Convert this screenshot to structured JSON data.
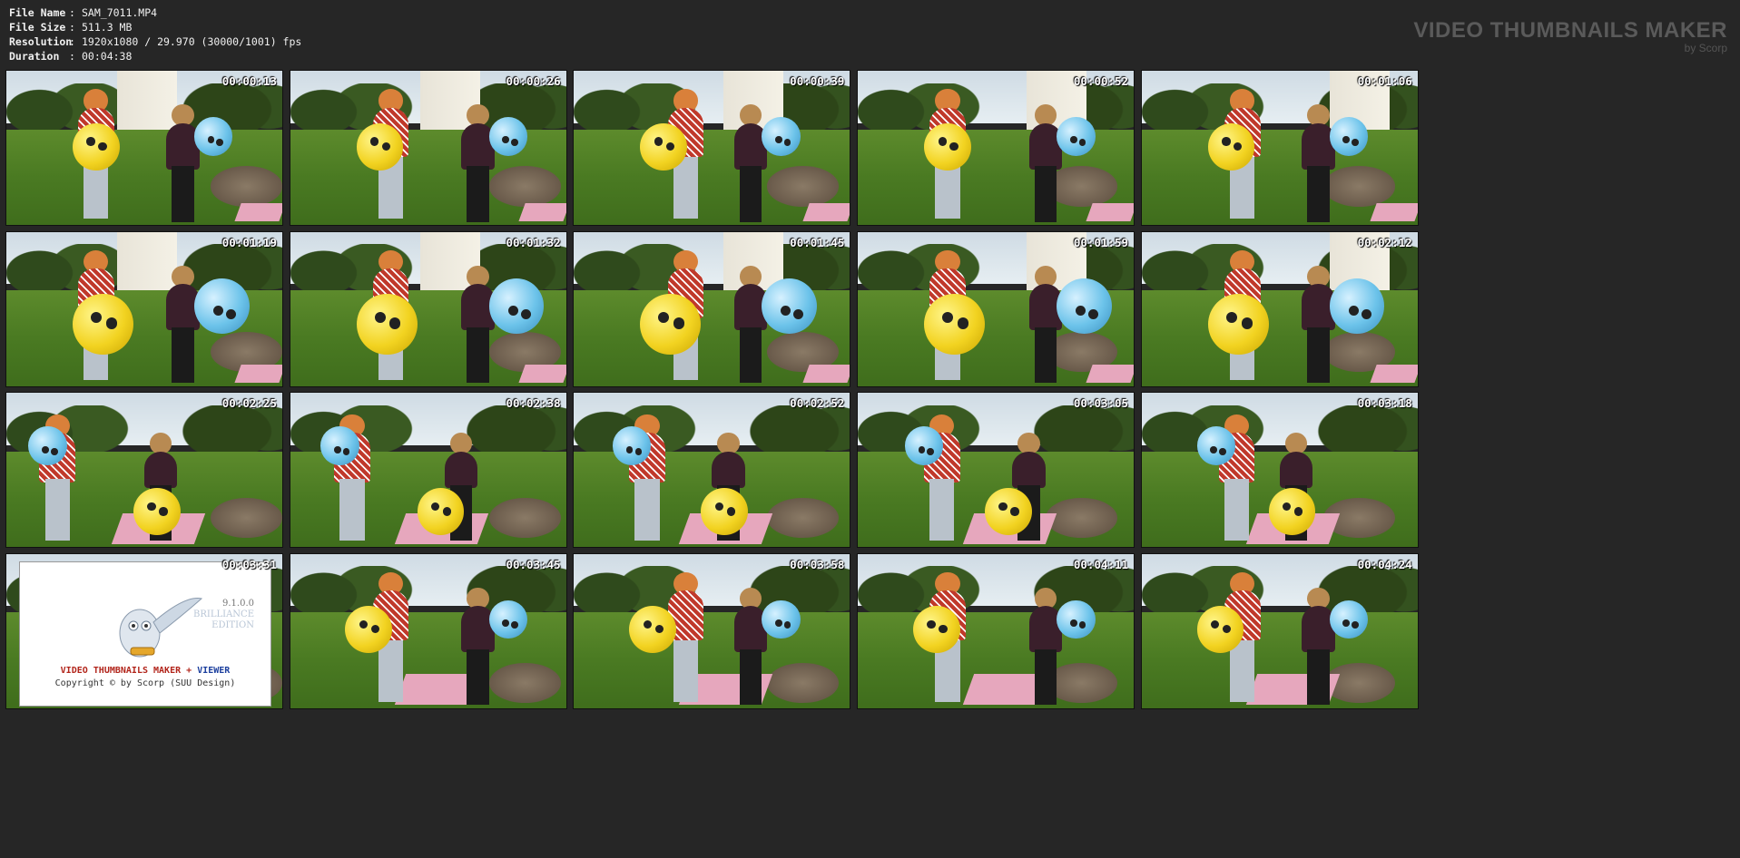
{
  "info": {
    "rows": [
      {
        "key": "File Name",
        "sep": ":",
        "value": "SAM_7011.MP4"
      },
      {
        "key": "File Size",
        "sep": ":",
        "value": "511.3 MB"
      },
      {
        "key": "Resolution",
        "sep": ":",
        "value": "1920x1080 / 29.970 (30000/1001) fps"
      },
      {
        "key": "Duration",
        "sep": ":",
        "value": "00:04:38"
      }
    ]
  },
  "brand": {
    "title": "VIDEO THUMBNAILS MAKER",
    "subtitle": "by Scorp"
  },
  "thumbnails": [
    {
      "time": "00:00:13"
    },
    {
      "time": "00:00:26"
    },
    {
      "time": "00:00:39"
    },
    {
      "time": "00:00:52"
    },
    {
      "time": "00:01:06"
    },
    {
      "time": "00:01:19"
    },
    {
      "time": "00:01:32"
    },
    {
      "time": "00:01:45"
    },
    {
      "time": "00:01:59"
    },
    {
      "time": "00:02:12"
    },
    {
      "time": "00:02:25"
    },
    {
      "time": "00:02:38"
    },
    {
      "time": "00:02:52"
    },
    {
      "time": "00:03:05"
    },
    {
      "time": "00:03:18"
    },
    {
      "time": "00:03:31"
    },
    {
      "time": "00:03:45"
    },
    {
      "time": "00:03:58"
    },
    {
      "time": "00:04:11"
    },
    {
      "time": "00:04:24"
    }
  ],
  "splash": {
    "version": "9.1.0.0",
    "edition_line1": "BRILLIANCE",
    "edition_line2": "EDITION",
    "product_part1": "VIDEO THUMBNAILS MAKER",
    "product_plus": "+",
    "product_part2": "VIEWER",
    "copyright": "Copyright © by Scorp (SUU Design)"
  },
  "colors": {
    "background": "#262626",
    "yellow_balloon": "#f2d321",
    "blue_balloon": "#6cc3ea",
    "shirt_red": "#c0392b",
    "shirt_dark": "#3a1f2b"
  }
}
